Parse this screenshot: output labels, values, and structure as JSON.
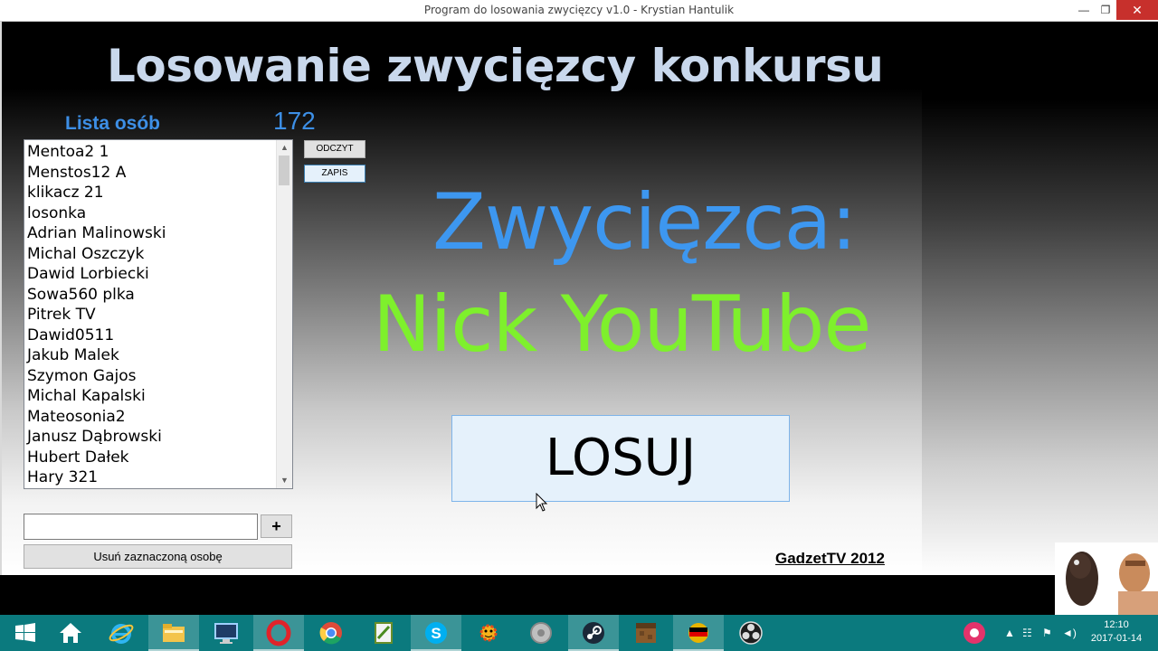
{
  "window": {
    "title": "Program do losowania zwycięzcy v1.0 - Krystian Hantulik",
    "minimize_glyph": "—",
    "maximize_glyph": "❐",
    "close_glyph": "✕"
  },
  "main": {
    "heading": "Losowanie zwycięzcy konkursu",
    "list_label": "Lista osób",
    "count": "172",
    "people": [
      "Mentoa2 1",
      "Menstos12 A",
      "klikacz 21",
      "losonka",
      "Adrian Malinowski",
      "Michal Oszczyk",
      "Dawid Lorbiecki",
      "Sowa560 plka",
      "Pitrek TV",
      "Dawid0511",
      "Jakub Malek",
      "Szymon Gajos",
      "Michal Kapalski",
      "Mateosonia2",
      "Janusz Dąbrowski",
      "Hubert Dałek",
      "Hary 321"
    ],
    "read_button": "ODCZYT",
    "save_button": "ZAPIS",
    "winner_label": "Zwycięzca:",
    "winner_name": "Nick YouTube",
    "draw_button": "LOSUJ",
    "add_input_value": "",
    "add_button": "+",
    "remove_button": "Usuń zaznaczoną osobę",
    "footer": "GadzetTV 2012"
  },
  "colors": {
    "heading": "#c9d8ec",
    "accent_blue": "#3d97f0",
    "winner_green": "#7ef02c",
    "taskbar": "#0b7a7e"
  },
  "taskbar": {
    "icons": [
      "windows-start-icon",
      "home-icon",
      "internet-explorer-icon",
      "file-explorer-icon",
      "monitor-icon",
      "opera-icon",
      "chrome-icon",
      "notepad-icon",
      "skype-icon",
      "sun-app-icon",
      "speaker-app-icon",
      "steam-icon",
      "minecraft-icon",
      "flag-app-icon",
      "obs-icon"
    ],
    "tray": {
      "time": "12:10",
      "date": "2017-01-14"
    }
  }
}
